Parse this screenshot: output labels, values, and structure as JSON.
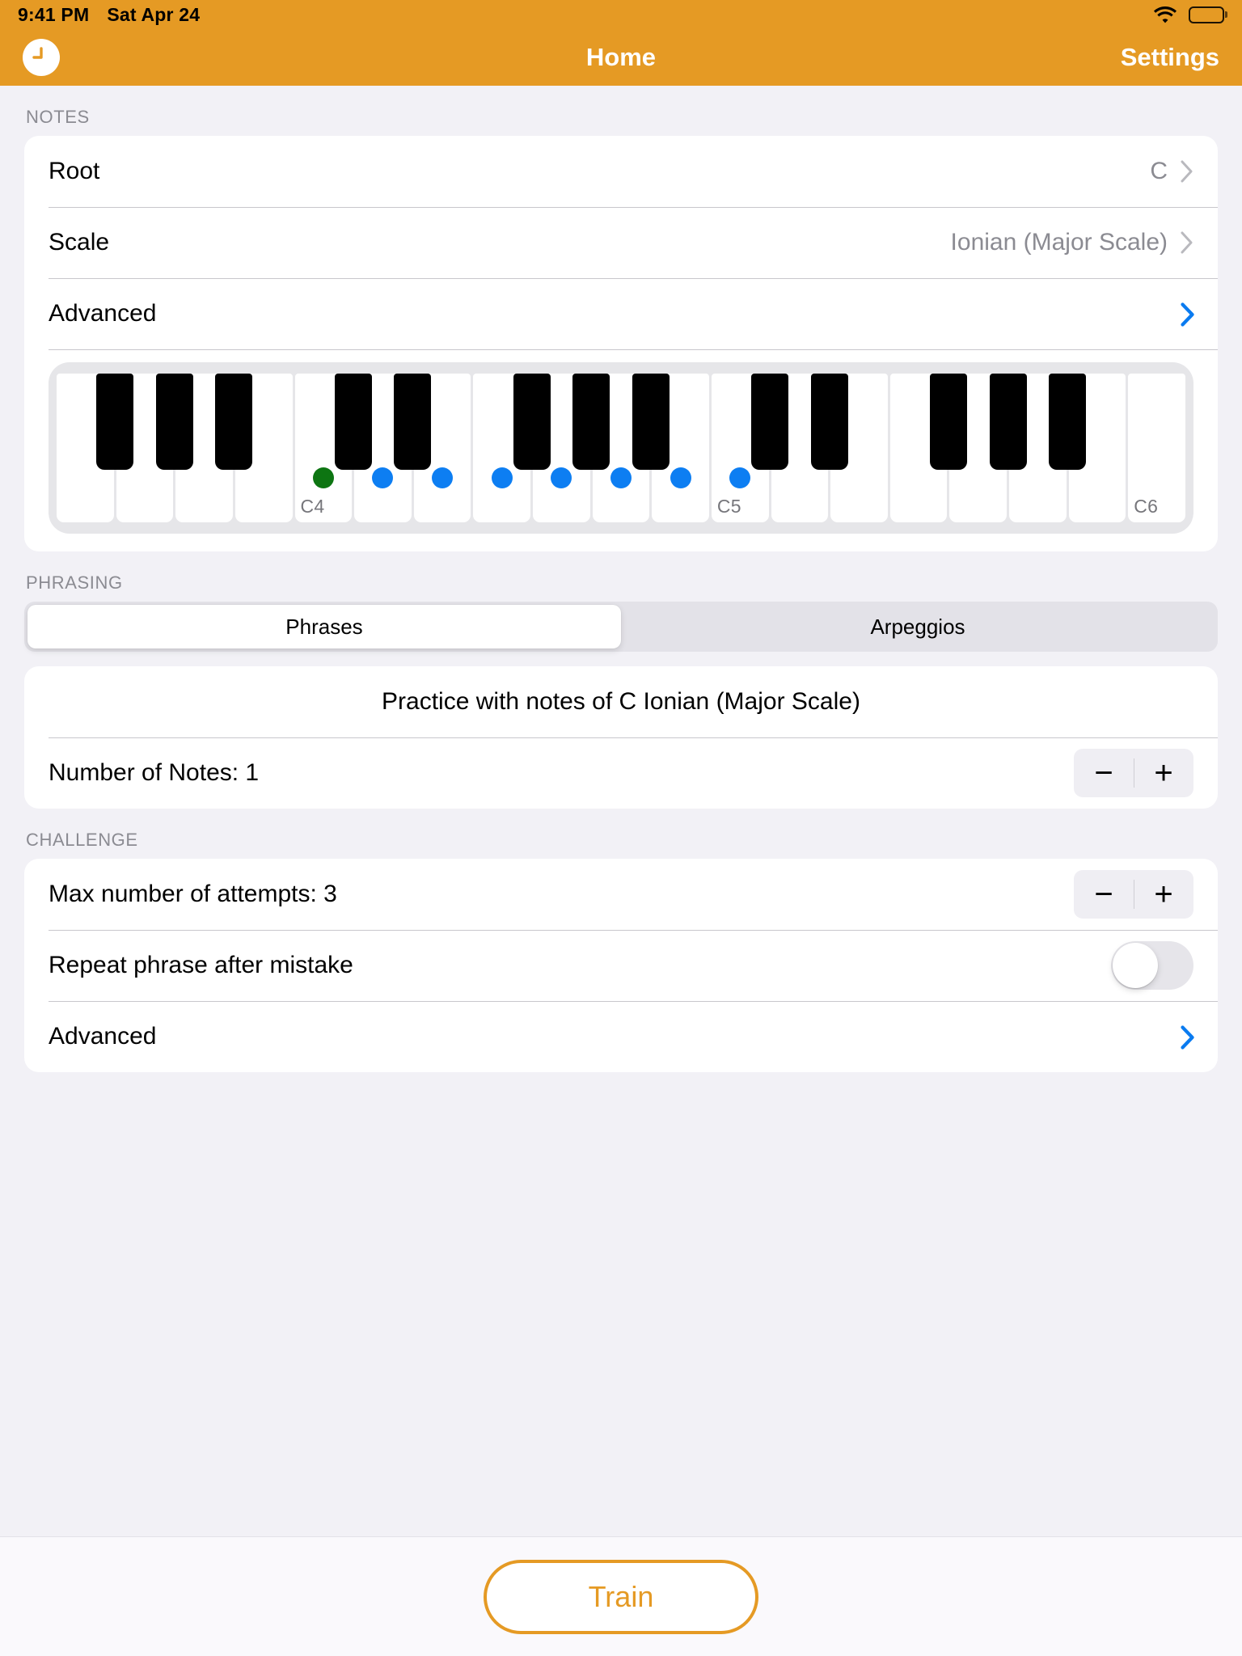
{
  "status_bar": {
    "time": "9:41 PM",
    "date": "Sat Apr 24",
    "wifi_icon": "wifi-icon",
    "battery_icon": "battery-full-icon"
  },
  "nav": {
    "left_icon": "clock-icon",
    "title": "Home",
    "settings_label": "Settings",
    "background_color": "#E59A24",
    "title_color": "#FFFFFF"
  },
  "notes_section": {
    "header": "NOTES",
    "rows": [
      {
        "label": "Root",
        "value": "C",
        "chevron": "chevron-right-icon",
        "chevron_color": "#B9B9BE"
      },
      {
        "label": "Scale",
        "value": "Ionian (Major Scale)",
        "chevron": "chevron-right-icon",
        "chevron_color": "#B9B9BE"
      },
      {
        "label": "Advanced",
        "value": "",
        "chevron": "chevron-right-icon",
        "chevron_color": "#0A7BF0"
      }
    ]
  },
  "keyboard": {
    "white_keys": [
      {
        "note": "F3",
        "dot": "none",
        "label": ""
      },
      {
        "note": "G3",
        "dot": "none",
        "label": ""
      },
      {
        "note": "A3",
        "dot": "none",
        "label": ""
      },
      {
        "note": "B3",
        "dot": "none",
        "label": ""
      },
      {
        "note": "C4",
        "dot": "green",
        "label": "C4"
      },
      {
        "note": "D4",
        "dot": "blue",
        "label": ""
      },
      {
        "note": "E4",
        "dot": "blue",
        "label": ""
      },
      {
        "note": "F4",
        "dot": "blue",
        "label": ""
      },
      {
        "note": "G4",
        "dot": "blue",
        "label": ""
      },
      {
        "note": "A4",
        "dot": "blue",
        "label": ""
      },
      {
        "note": "B4",
        "dot": "blue",
        "label": ""
      },
      {
        "note": "C5",
        "dot": "blue",
        "label": "C5"
      },
      {
        "note": "D5",
        "dot": "none",
        "label": ""
      },
      {
        "note": "E5",
        "dot": "none",
        "label": ""
      },
      {
        "note": "F5",
        "dot": "none",
        "label": ""
      },
      {
        "note": "G5",
        "dot": "none",
        "label": ""
      },
      {
        "note": "A5",
        "dot": "none",
        "label": ""
      },
      {
        "note": "B5",
        "dot": "none",
        "label": ""
      },
      {
        "note": "C6",
        "dot": "none",
        "label": "C6"
      }
    ],
    "black_key_slots": [
      0,
      1,
      3,
      4,
      5,
      7,
      8,
      10,
      11,
      12,
      14,
      15,
      17,
      18
    ],
    "dot_colors": {
      "root": "#0D7512",
      "scale": "#0D7EF2"
    },
    "labels": [
      "C4",
      "C5",
      "C6"
    ]
  },
  "phrasing_section": {
    "header": "PHRASING",
    "segments": [
      {
        "label": "Phrases",
        "selected": true
      },
      {
        "label": "Arpeggios",
        "selected": false
      }
    ],
    "practice_text": "Practice with notes of C Ionian (Major Scale)",
    "number_of_notes_label": "Number of Notes: 1",
    "stepper_minus": "−",
    "stepper_plus": "+"
  },
  "challenge_section": {
    "header": "CHALLENGE",
    "max_attempts_label": "Max number of attempts: 3",
    "stepper_minus": "−",
    "stepper_plus": "+",
    "repeat_label": "Repeat phrase after mistake",
    "repeat_toggle_on": false,
    "advanced_label": "Advanced",
    "advanced_chevron_color": "#0A7BF0"
  },
  "footer": {
    "train_label": "Train",
    "train_color": "#E59A24"
  }
}
